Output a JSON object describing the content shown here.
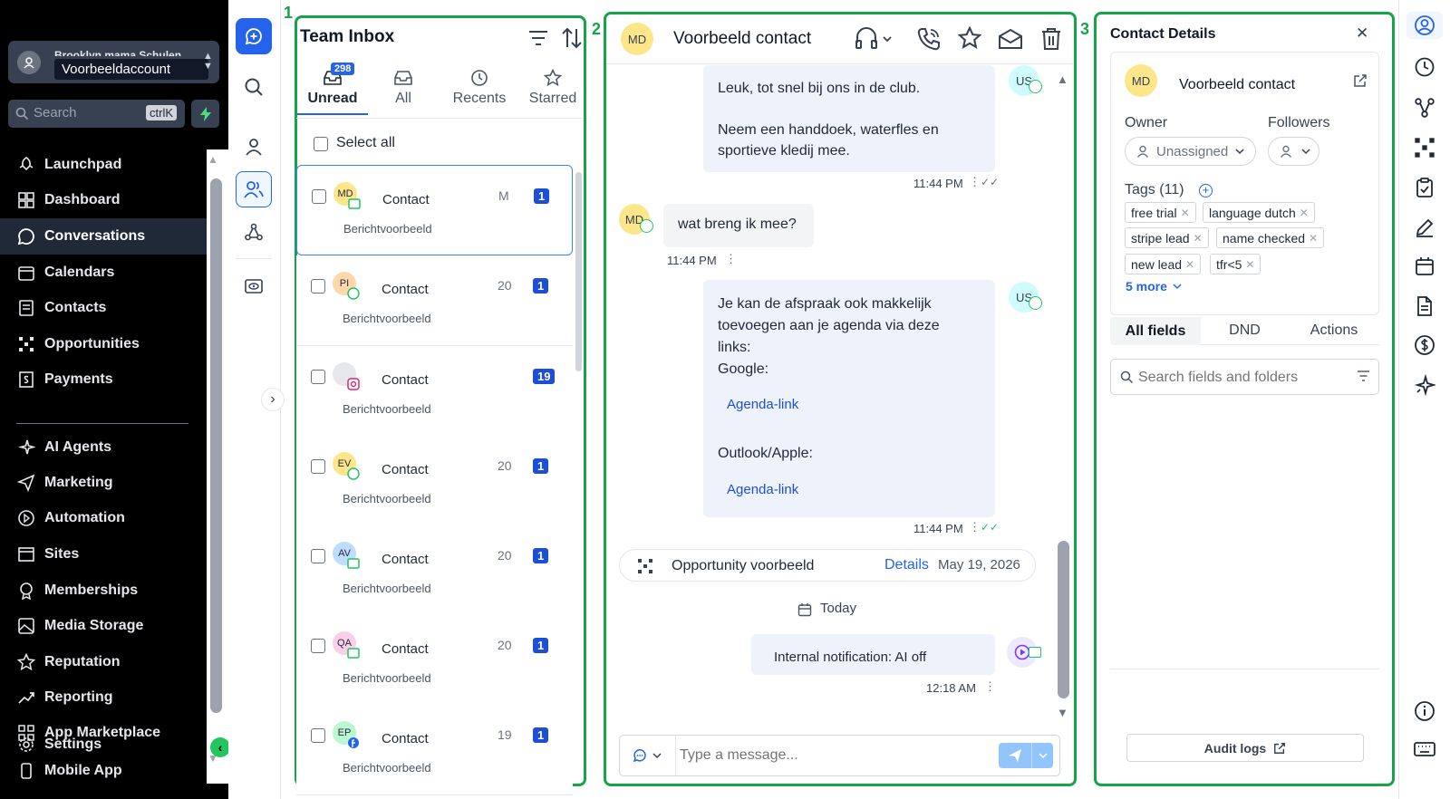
{
  "sidebar": {
    "account_sub": "Brooklyn mama Schulen",
    "account_name": "Voorbeeldaccount",
    "search_label": "Search",
    "search_shortcut": "ctrlK",
    "items": [
      {
        "label": "Launchpad",
        "icon": "rocket-icon"
      },
      {
        "label": "Dashboard",
        "icon": "dashboard-icon"
      },
      {
        "label": "Conversations",
        "icon": "chat-icon",
        "active": true
      },
      {
        "label": "Calendars",
        "icon": "calendar-icon"
      },
      {
        "label": "Contacts",
        "icon": "contacts-icon"
      },
      {
        "label": "Opportunities",
        "icon": "opportunities-icon"
      },
      {
        "label": "Payments",
        "icon": "payments-icon"
      }
    ],
    "items2": [
      {
        "label": "AI Agents",
        "icon": "sparkle-icon"
      },
      {
        "label": "Marketing",
        "icon": "send-icon"
      },
      {
        "label": "Automation",
        "icon": "automation-icon"
      },
      {
        "label": "Sites",
        "icon": "sites-icon"
      },
      {
        "label": "Memberships",
        "icon": "memberships-icon"
      },
      {
        "label": "Media Storage",
        "icon": "image-icon"
      },
      {
        "label": "Reputation",
        "icon": "star-icon"
      },
      {
        "label": "Reporting",
        "icon": "trend-icon"
      },
      {
        "label": "App Marketplace",
        "icon": "grid-icon"
      },
      {
        "label": "Settings",
        "icon": "gear-icon"
      },
      {
        "label": "Mobile App",
        "icon": "mobile-icon"
      }
    ]
  },
  "labels": {
    "one": "1",
    "two": "2",
    "three": "3"
  },
  "inbox": {
    "title": "Team Inbox",
    "tabs": [
      {
        "label": "Unread",
        "count": "298"
      },
      {
        "label": "All"
      },
      {
        "label": "Recents"
      },
      {
        "label": "Starred"
      }
    ],
    "select_all": "Select all",
    "cards": [
      {
        "initials": "MD",
        "name": "Contact",
        "preview": "Berichtvoorbeeld",
        "date": "M",
        "badge": "1",
        "avatar_bg": "#fde68a",
        "channel": "sms"
      },
      {
        "initials": "PI",
        "name": "Contact",
        "preview": "Berichtvoorbeeld",
        "date": "20",
        "badge": "1",
        "avatar_bg": "#fed7aa",
        "channel": "whatsapp"
      },
      {
        "initials": "",
        "name": "Contact",
        "preview": "Berichtvoorbeeld",
        "date": "",
        "badge": "19",
        "avatar_bg": "#e5e7eb",
        "channel": "instagram"
      },
      {
        "initials": "EV",
        "name": "Contact",
        "preview": "Berichtvoorbeeld",
        "date": "20",
        "badge": "1",
        "avatar_bg": "#fde68a",
        "channel": "whatsapp"
      },
      {
        "initials": "AV",
        "name": "Contact",
        "preview": "Berichtvoorbeeld",
        "date": "20",
        "badge": "1",
        "avatar_bg": "#bfdbfe",
        "channel": "sms"
      },
      {
        "initials": "QA",
        "name": "Contact",
        "preview": "Berichtvoorbeeld",
        "date": "20",
        "badge": "1",
        "avatar_bg": "#fbcfe8",
        "channel": "sms"
      },
      {
        "initials": "EP",
        "name": "Contact",
        "preview": "Berichtvoorbeeld",
        "date": "19",
        "badge": "1",
        "avatar_bg": "#bbf7d0",
        "channel": "facebook"
      }
    ]
  },
  "chat": {
    "contact_initials": "MD",
    "contact_name": "Voorbeeld contact",
    "messages": {
      "m1_l1": "Leuk, tot snel bij ons in de club.",
      "m1_l2": "Neem een handdoek, waterfles en",
      "m1_l3": "sportieve kledij mee.",
      "m1_time": "11:44 PM",
      "m2": "wat breng ik mee?",
      "m2_time": "11:44 PM",
      "m3_l1": "Je kan de afspraak ook makkelijk",
      "m3_l2": "toevoegen aan je agenda via deze",
      "m3_l3": "links:",
      "m3_l4": "Google:",
      "m3_link1": "Agenda-link",
      "m3_l5": "Outlook/Apple:",
      "m3_link2": "Agenda-link",
      "m3_time": "11:44 PM",
      "us_initials": "US"
    },
    "opportunity": {
      "name": "Opportunity voorbeeld",
      "details": "Details",
      "date": "May 19, 2026"
    },
    "divider": "Today",
    "internal": {
      "text": "Internal notification: AI off",
      "time": "12:18 AM"
    },
    "composer_placeholder": "Type a message..."
  },
  "details": {
    "title": "Contact Details",
    "initials": "MD",
    "name": "Voorbeeld contact",
    "owner_label": "Owner",
    "owner_value": "Unassigned",
    "followers_label": "Followers",
    "tags_label": "Tags (11)",
    "tags": [
      "free trial",
      "language dutch",
      "stripe lead",
      "name checked",
      "new lead",
      "tfr<5"
    ],
    "more": "5 more",
    "tabs": [
      "All fields",
      "DND",
      "Actions"
    ],
    "search_placeholder": "Search fields and folders",
    "audit": "Audit logs"
  },
  "colors": {
    "accent": "#2563eb",
    "frame": "#16a34a",
    "badge": "#1d4ed8"
  }
}
